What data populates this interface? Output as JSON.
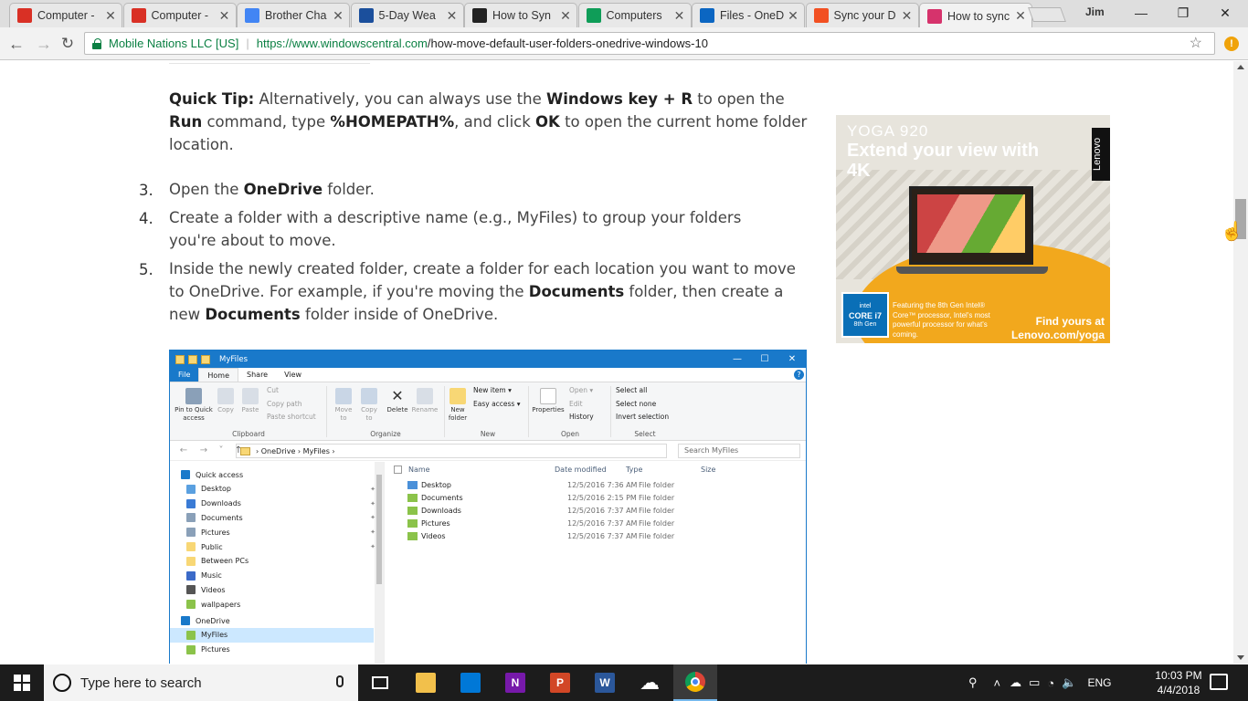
{
  "browser": {
    "tabs": [
      {
        "title": "Computer -",
        "favicon": "gmail-icon",
        "color": "#d93025"
      },
      {
        "title": "Computer -",
        "favicon": "gmail-icon",
        "color": "#d93025"
      },
      {
        "title": "Brother Cha",
        "favicon": "docs-icon",
        "color": "#4285f4"
      },
      {
        "title": "5-Day Wea",
        "favicon": "weather-channel-icon",
        "color": "#1b4f9c"
      },
      {
        "title": "How to Syn",
        "favicon": "htg-icon",
        "color": "#222222"
      },
      {
        "title": "Computers",
        "favicon": "drive-icon",
        "color": "#0f9d58"
      },
      {
        "title": "Files - OneD",
        "favicon": "onedrive-icon",
        "color": "#0b66c2"
      },
      {
        "title": "Sync your D",
        "favicon": "microsoft-icon",
        "color": "#f25022"
      },
      {
        "title": "How to sync",
        "favicon": "windowscentral-icon",
        "color": "#d6336c"
      }
    ],
    "profile_label": "Jim",
    "window_controls": {
      "minimize": "—",
      "restore": "❐",
      "close": "✕"
    },
    "address": {
      "secure_label": "Mobile Nations LLC [US]",
      "scheme": "https://",
      "domain": "www.windowscentral.com",
      "path": "/how-move-default-user-folders-onedrive-windows-10"
    },
    "ext_badge": "!"
  },
  "article": {
    "quick_tip": {
      "label": "Quick Tip:",
      "t1": " Alternatively, you can always use the ",
      "b1": "Windows key + R",
      "t2": " to open the ",
      "b2": "Run",
      "t3": " command, type ",
      "b3": "%HOMEPATH%",
      "t4": ", and click ",
      "b4": "OK",
      "t5": " to open the current home folder location."
    },
    "steps": [
      {
        "num": "3.",
        "t1": "Open the ",
        "b1": "OneDrive",
        "t2": " folder."
      },
      {
        "num": "4.",
        "t1": "Create a folder with a descriptive name (e.g., MyFiles) to group your folders you're about to move."
      },
      {
        "num": "5.",
        "t1": "Inside the newly created folder, create a folder for each location you want to move to OneDrive. For example, if you're moving the ",
        "b1": "Documents",
        "t2": " folder, then create a new ",
        "b2": "Documents",
        "t3": " folder inside of OneDrive."
      }
    ]
  },
  "ad": {
    "brand_line": "YOGA 920",
    "headline": "Extend your view with 4K",
    "side_brand": "Lenovo",
    "intel_badge": {
      "line1": "intel",
      "line2": "CORE i7",
      "line3": "8th Gen"
    },
    "feature_text": "Featuring the 8th Gen Intel® Core™ processor, Intel's most powerful processor for what's coming.",
    "cta_line1": "Find yours at",
    "cta_line2": "Lenovo.com/yoga"
  },
  "explorer": {
    "window_title": "MyFiles",
    "controls": {
      "minimize": "—",
      "maximize": "☐",
      "close": "✕"
    },
    "ribbon_tabs": [
      "File",
      "Home",
      "Share",
      "View"
    ],
    "groups": {
      "clipboard": {
        "label": "Clipboard",
        "pin": "Pin to Quick access",
        "copy": "Copy",
        "paste": "Paste",
        "cut": "Cut",
        "copy_path": "Copy path",
        "paste_shortcut": "Paste shortcut"
      },
      "organize": {
        "label": "Organize",
        "move_to": "Move to",
        "copy_to": "Copy to",
        "delete": "Delete",
        "rename": "Rename"
      },
      "new": {
        "label": "New",
        "new_folder": "New folder",
        "new_item": "New item ▾",
        "easy_access": "Easy access ▾"
      },
      "open": {
        "label": "Open",
        "properties": "Properties",
        "open": "Open ▾",
        "edit": "Edit",
        "history": "History"
      },
      "select": {
        "label": "Select",
        "select_all": "Select all",
        "select_none": "Select none",
        "invert": "Invert selection"
      }
    },
    "breadcrumb": [
      "OneDrive",
      "MyFiles"
    ],
    "search_placeholder": "Search MyFiles",
    "nav": [
      {
        "label": "Quick access",
        "pin": false
      },
      {
        "label": "Desktop",
        "pin": true
      },
      {
        "label": "Downloads",
        "pin": true
      },
      {
        "label": "Documents",
        "pin": true
      },
      {
        "label": "Pictures",
        "pin": true
      },
      {
        "label": "Public",
        "pin": true
      },
      {
        "label": "Between PCs",
        "pin": false
      },
      {
        "label": "Music",
        "pin": false
      },
      {
        "label": "Videos",
        "pin": false
      },
      {
        "label": "wallpapers",
        "pin": false
      },
      {
        "label": "OneDrive",
        "pin": false
      },
      {
        "label": "MyFiles",
        "pin": false
      },
      {
        "label": "Pictures",
        "pin": false
      }
    ],
    "columns": [
      "Name",
      "Date modified",
      "Type",
      "Size"
    ],
    "files": [
      {
        "name": "Desktop",
        "date": "12/5/2016 7:36 AM",
        "type": "File folder"
      },
      {
        "name": "Documents",
        "date": "12/5/2016 2:15 PM",
        "type": "File folder"
      },
      {
        "name": "Downloads",
        "date": "12/5/2016 7:37 AM",
        "type": "File folder"
      },
      {
        "name": "Pictures",
        "date": "12/5/2016 7:37 AM",
        "type": "File folder"
      },
      {
        "name": "Videos",
        "date": "12/5/2016 7:37 AM",
        "type": "File folder"
      }
    ]
  },
  "taskbar": {
    "search_placeholder": "Type here to search",
    "apps": [
      {
        "name": "task-view-icon"
      },
      {
        "name": "file-explorer-icon",
        "color": "#f2c04b"
      },
      {
        "name": "store-icon",
        "color": "#0078d7"
      },
      {
        "name": "onenote-icon",
        "color": "#7719aa",
        "letter": "N"
      },
      {
        "name": "powerpoint-icon",
        "color": "#d24726",
        "letter": "P"
      },
      {
        "name": "word-icon",
        "color": "#2b579a",
        "letter": "W"
      },
      {
        "name": "onedrive-icon",
        "color": "#ffffff"
      },
      {
        "name": "chrome-icon",
        "color": "#db4437"
      }
    ],
    "lang": "ENG",
    "time": "10:03 PM",
    "date": "4/4/2018"
  }
}
